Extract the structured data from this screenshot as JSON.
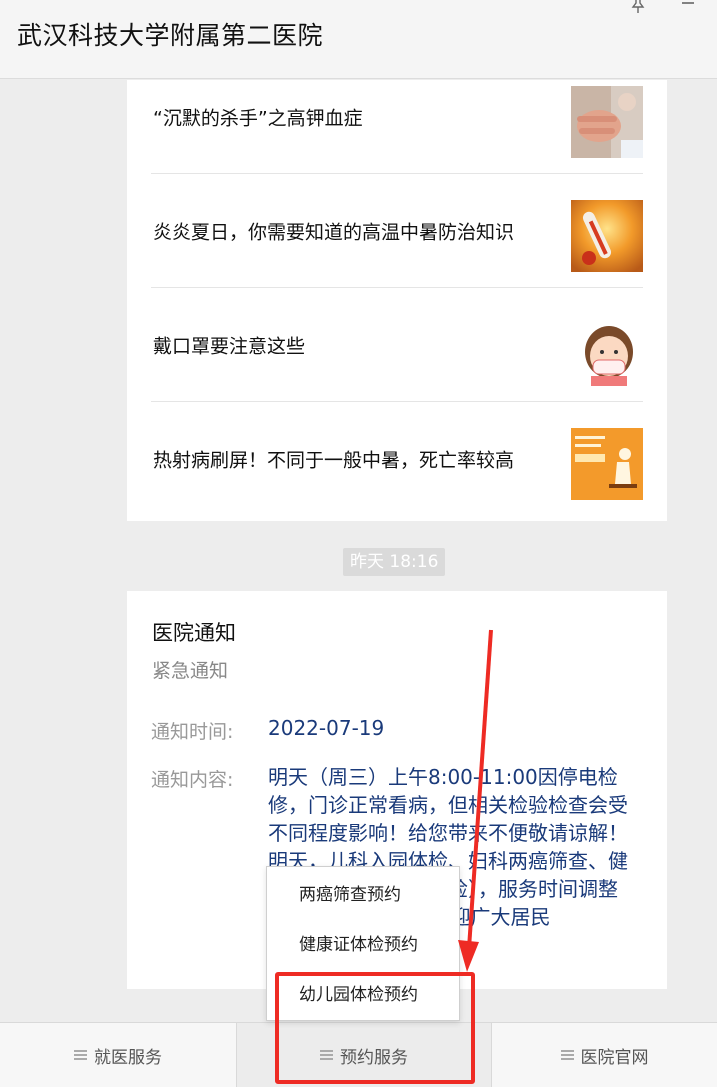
{
  "window": {
    "title": "武汉科技大学附属第二医院"
  },
  "articles": [
    {
      "title": "“沉默的杀手”之高钾血症"
    },
    {
      "title": "炎炎夏日，你需要知道的高温中暑防治知识"
    },
    {
      "title": "戴口罩要注意这些"
    },
    {
      "title": "热射病刷屏！不同于一般中暑，死亡率较高"
    }
  ],
  "timestamp": "昨天  18:16",
  "notice": {
    "title": "医院通知",
    "subtitle": "紧急通知",
    "time_label": "通知时间:",
    "time_value": "2022-07-19",
    "content_label": "通知内容:",
    "content_value": "明天（周三）上午8:00-11:00因停电检修，门诊正常看病，但相关检验检查会受不同程度影响！给您带来不便敬请谅解！明天，儿科入园体检、妇科两癌筛查、健康证体检（预防性体检），服务时间调整为14:00-17:00。欢迎广大居民"
  },
  "popup_menu": {
    "items": [
      "两癌筛查预约",
      "健康证体检预约",
      "幼儿园体检预约"
    ]
  },
  "bottom_tabs": [
    "就医服务",
    "预约服务",
    "医院官网"
  ],
  "colors": {
    "accent_red": "#ee2b24",
    "link_blue": "#1a3a7a"
  }
}
